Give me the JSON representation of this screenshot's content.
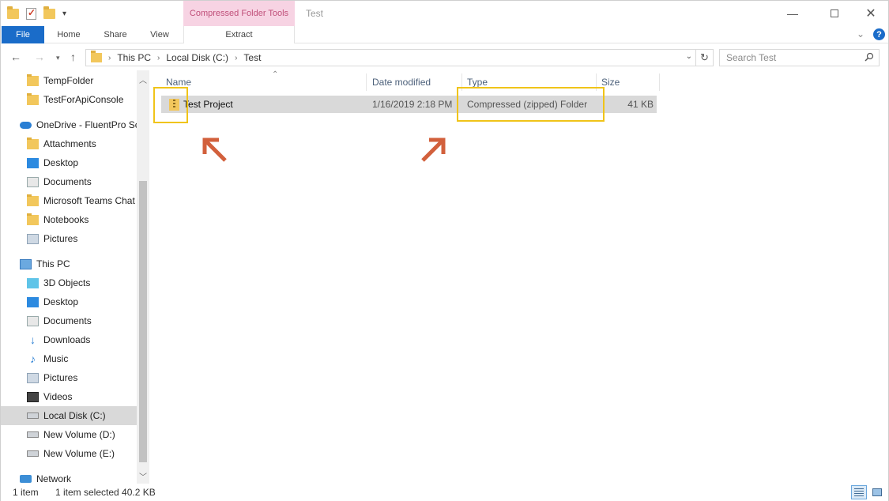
{
  "window": {
    "title": "Test",
    "contextual_tab_group": "Compressed Folder Tools"
  },
  "ribbon": {
    "tabs": [
      "File",
      "Home",
      "Share",
      "View",
      "Extract"
    ]
  },
  "address": {
    "crumbs": [
      "This PC",
      "Local Disk (C:)",
      "Test"
    ]
  },
  "search": {
    "placeholder": "Search Test"
  },
  "navpane": {
    "items": [
      {
        "label": "TempFolder",
        "icon": "folder-icon"
      },
      {
        "label": "TestForApiConsole",
        "icon": "folder-icon"
      },
      {
        "label": "OneDrive - FluentPro Sc",
        "icon": "cloud-icon"
      },
      {
        "label": "Attachments",
        "icon": "folder-icon"
      },
      {
        "label": "Desktop",
        "icon": "desktop-icon"
      },
      {
        "label": "Documents",
        "icon": "documents-icon"
      },
      {
        "label": "Microsoft Teams Chat",
        "icon": "folder-icon"
      },
      {
        "label": "Notebooks",
        "icon": "folder-icon"
      },
      {
        "label": "Pictures",
        "icon": "pictures-icon"
      },
      {
        "label": "This PC",
        "icon": "computer-icon"
      },
      {
        "label": "3D Objects",
        "icon": "cube-icon"
      },
      {
        "label": "Desktop",
        "icon": "desktop-icon"
      },
      {
        "label": "Documents",
        "icon": "documents-icon"
      },
      {
        "label": "Downloads",
        "icon": "download-icon"
      },
      {
        "label": "Music",
        "icon": "music-icon"
      },
      {
        "label": "Pictures",
        "icon": "pictures-icon"
      },
      {
        "label": "Videos",
        "icon": "video-icon"
      },
      {
        "label": "Local Disk (C:)",
        "icon": "disk-icon",
        "selected": true
      },
      {
        "label": "New Volume (D:)",
        "icon": "disk-icon"
      },
      {
        "label": "New Volume (E:)",
        "icon": "disk-icon"
      },
      {
        "label": "Network",
        "icon": "network-icon"
      }
    ]
  },
  "columns": {
    "name": "Name",
    "date": "Date modified",
    "type": "Type",
    "size": "Size"
  },
  "files": [
    {
      "name": "Test Project",
      "date": "1/16/2019 2:18 PM",
      "type": "Compressed (zipped) Folder",
      "size": "41 KB",
      "icon": "zip-folder-icon"
    }
  ],
  "status": {
    "count": "1 item",
    "selection": "1 item selected  40.2 KB"
  },
  "colors": {
    "accent": "#1a6cc9",
    "contextual_tab": "#f7d3e3",
    "highlight": "#f0c419",
    "arrow": "#d2603c"
  }
}
